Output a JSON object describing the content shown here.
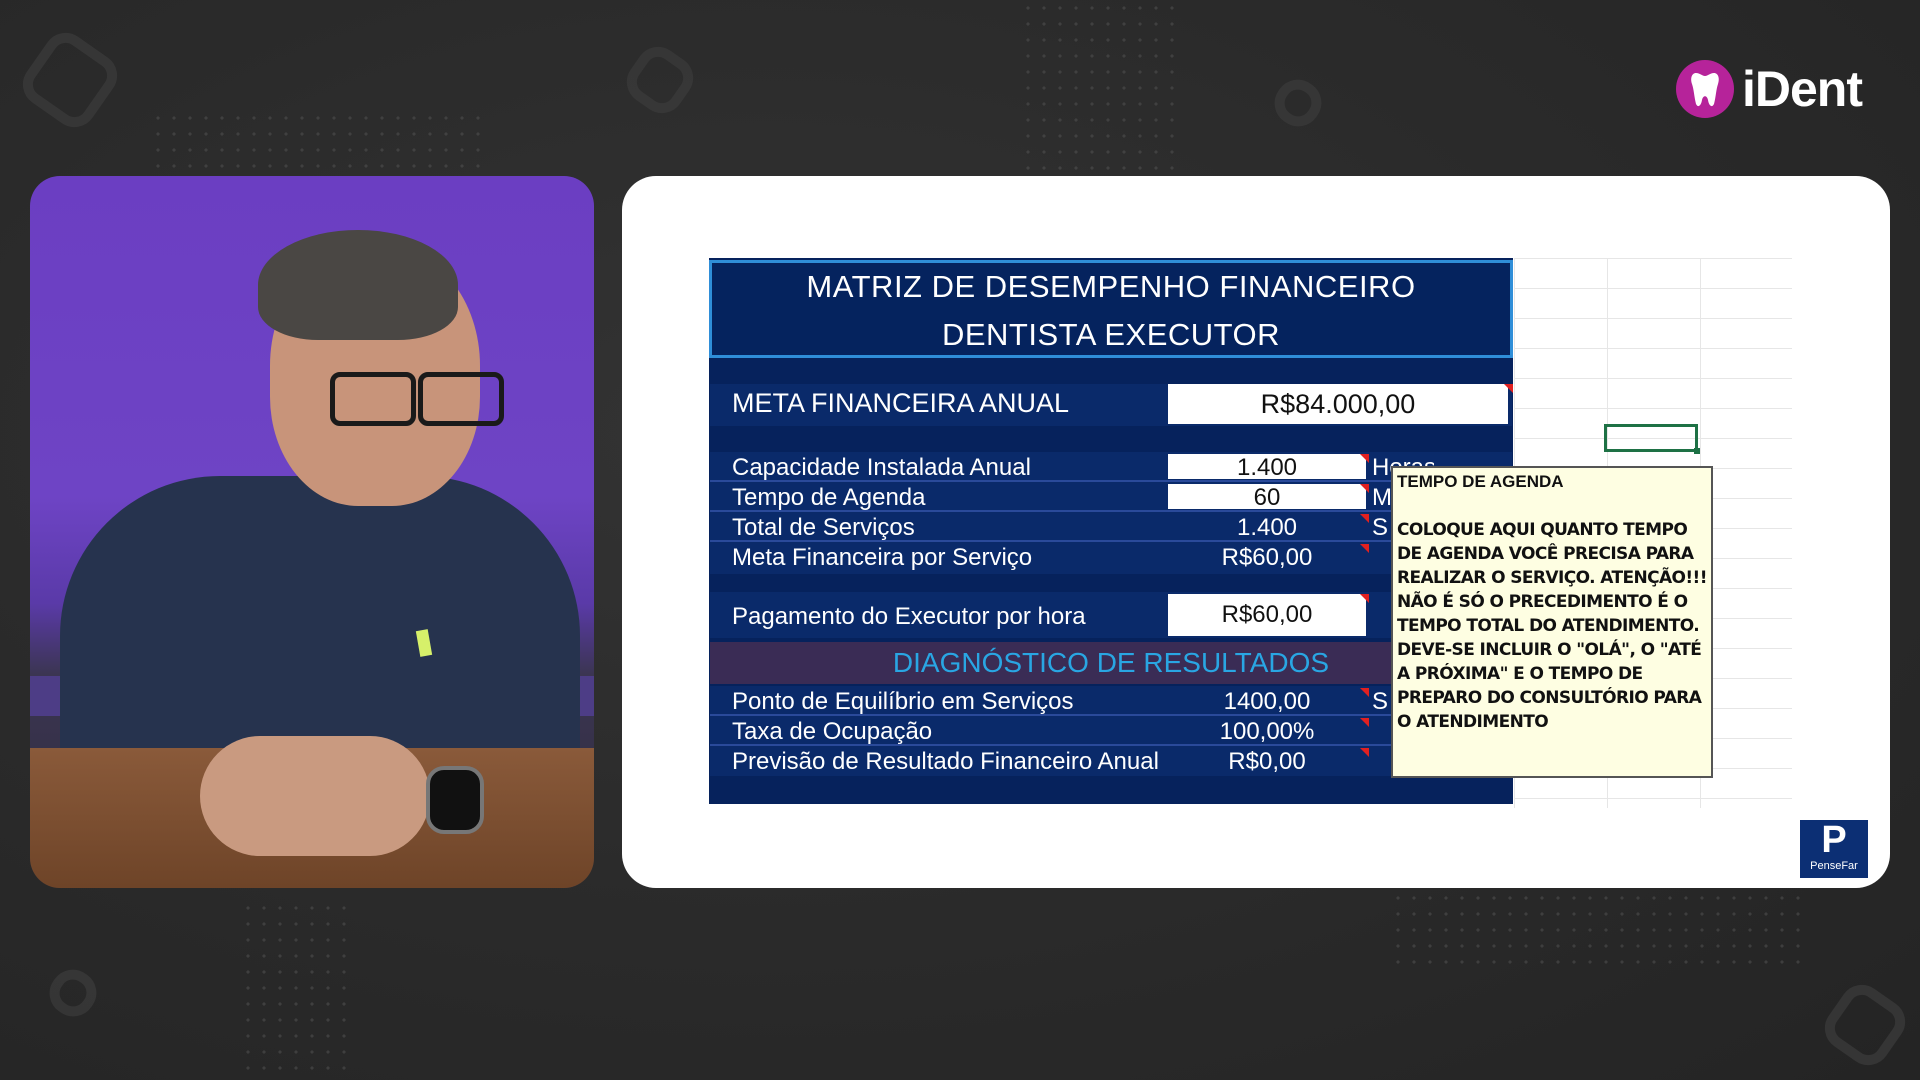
{
  "brand": {
    "logo_text": "iDent",
    "logo_color": "#b6239a"
  },
  "matrix": {
    "title_line1": "MATRIZ DE DESEMPENHO FINANCEIRO",
    "title_line2": "DENTISTA EXECUTOR",
    "meta_label": "META FINANCEIRA ANUAL",
    "meta_value": "R$84.000,00",
    "rows_top": [
      {
        "label": "Capacidade   Instalada   Anual",
        "value": "1.400",
        "unit": "Horas"
      },
      {
        "label": "Tempo de Agenda",
        "value": "60",
        "unit": "M"
      },
      {
        "label": "Total de Serviços",
        "value": "1.400",
        "unit": "S"
      },
      {
        "label": "Meta Financeira por Serviço",
        "value": "R$60,00",
        "unit": ""
      }
    ],
    "payment_label": "Pagamento do Executor por hora",
    "payment_value": "R$60,00",
    "diagnostic_header": "DIAGNÓSTICO DE RESULTADOS",
    "rows_bottom": [
      {
        "label": "Ponto de Equilíbrio em Serviços",
        "value": "1400,00",
        "unit": "S"
      },
      {
        "label": "Taxa de Ocupação",
        "value": "100,00%",
        "unit": ""
      },
      {
        "label": "Previsão de Resultado Financeiro Anual",
        "value": "R$0,00",
        "unit": ""
      }
    ]
  },
  "comment": {
    "title": "TEMPO DE AGENDA",
    "body": "COLOQUE AQUI QUANTO TEMPO DE AGENDA VOCÊ PRECISA PARA REALIZAR O SERVIÇO. ATENÇÃO!!! NÃO É SÓ O PRECEDIMENTO É O TEMPO TOTAL DO ATENDIMENTO. DEVE-SE INCLUIR O \"OLÁ\", O \"ATÉ A PRÓXIMA\" E O TEMPO DE PREPARO DO CONSULTÓRIO PARA O ATENDIMENTO"
  },
  "watermark": {
    "letter": "P",
    "text": "PenseFar"
  },
  "colors": {
    "sheet_navy": "#06225c",
    "diag_text": "#29a6e3",
    "comment_bg": "#fefee2"
  }
}
